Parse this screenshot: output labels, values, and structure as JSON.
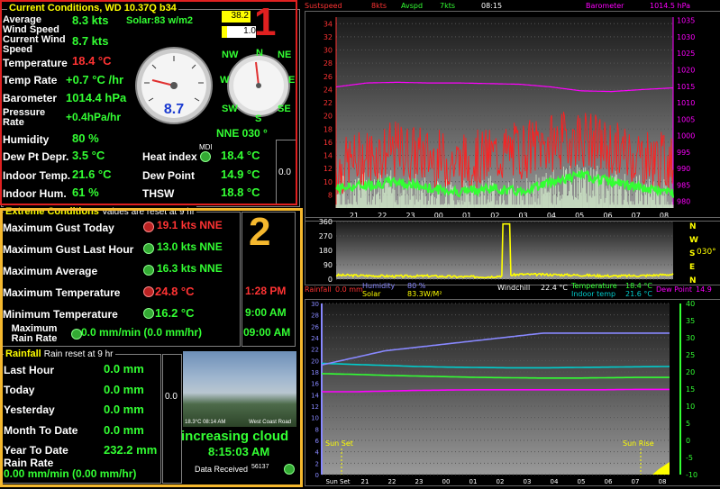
{
  "current": {
    "title": "Current Conditions, WD 10.37Q b34",
    "solar": "Solar:83 w/m2",
    "avg_speed_label": "Average Wind Speed",
    "avg_speed": "8.3 kts",
    "cur_speed_label": "Current Wind Speed",
    "cur_speed": "8.7 kts",
    "temp_label": "Temperature",
    "temp": "18.4 °C",
    "temp_rate_label": "Temp Rate",
    "temp_rate": "+0.7 °C /hr",
    "baro_label": "Barometer",
    "baro": "1014.4 hPa",
    "press_rate_label": "Pressure Rate",
    "press_rate": "+0.4hPa/hr",
    "humidity_label": "Humidity",
    "humidity": "80 %",
    "dewdep_label": "Dew Pt Depr.",
    "dewdep": "3.5 °C",
    "indoor_temp_label": "Indoor Temp.",
    "indoor_temp": "21.6 °C",
    "indoor_hum_label": "Indoor Hum.",
    "indoor_hum": "61 %",
    "heat_label": "Heat index",
    "heat": "18.4 °C",
    "mdi": "MDI",
    "dew_label": "Dew Point",
    "dew": "14.9 °C",
    "thsw_label": "THSW",
    "thsw": "18.8 °C",
    "gauge_value": "8.7",
    "small_box_top": "38.2",
    "small_box_mid": "1.0",
    "rain_bar_value": "0.0",
    "direction": "NNE  030 °",
    "compass": {
      "n": "N",
      "s": "S",
      "e": "E",
      "w": "W",
      "nw": "NW",
      "ne": "NE",
      "sw": "SW",
      "se": "SE"
    }
  },
  "extreme": {
    "title": "Extreme Conditions",
    "subtitle": "Values are reset at 9 hr",
    "gust_today_label": "Maximum Gust Today",
    "gust_today": "19.1 kts NNE",
    "gust_hour_label": "Maximum Gust Last Hour",
    "gust_hour": "13.0 kts NNE",
    "avg_label": "Maximum Average",
    "avg": "16.3 kts NNE",
    "tmax_label": "Maximum Temperature",
    "tmax": "24.8 °C",
    "tmax_time": "1:28 PM",
    "tmin_label": "Minimum Temperature",
    "tmin": "16.2 °C",
    "tmin_time": "9:00 AM",
    "rain_rate_label": "Maximum Rain Rate",
    "rain_rate": "0.0 mm/min (0.0 mm/hr)",
    "rain_rate_time": "09:00 AM"
  },
  "rainfall": {
    "title": "Rainfall",
    "subtitle": "Rain reset at 9 hr",
    "last_hour_label": "Last Hour",
    "last_hour": "0.0 mm",
    "today_label": "Today",
    "today": "0.0 mm",
    "yesterday_label": "Yesterday",
    "yesterday": "0.0 mm",
    "month_label": "Month To Date",
    "month": "0.0 mm",
    "year_label": "Year To Date",
    "year": "232.2 mm",
    "rate_label": "Rain Rate",
    "rate": "0.00 mm/min (0.00 mm/hr)",
    "bar_value": "0.0"
  },
  "camera": {
    "caption_left": "18.3°C 08:14 AM",
    "caption_right": "West Coast Road",
    "forecast": "increasing cloud",
    "time": "8:15:03 AM",
    "data_received_label": "Data Received",
    "data_received": "56137"
  },
  "annotations": {
    "box1": "1",
    "box2": "2"
  },
  "colors": {
    "good": "#33ff33",
    "alert": "#ff3333",
    "title": "#ffff00",
    "box1": "#e02020",
    "box2": "#f5b82e"
  },
  "top_chart_header": {
    "sustspeed": "Sustspeed",
    "wind_val": "8kts",
    "avspd": "Avspd",
    "avg_val": "7kts",
    "time": "08:15",
    "baro_label": "Barometer",
    "baro_val": "1014.5 hPa"
  },
  "wind_dir_chart": {
    "value_text": "030°",
    "dir_labels": [
      "N",
      "W",
      "S",
      "E",
      "N"
    ]
  },
  "bottom_chart_header": {
    "rainfall": "Rainfall",
    "rain_val": "0.0 mm",
    "humidity": "Humidity",
    "humidity_val": "80 %",
    "solar": "Solar",
    "solar_val": "83.3W/M²",
    "windchill": "Windchill",
    "windchill_val": "22.4 °C",
    "temperature": "Temperature",
    "temperature_val": "18.4 °C",
    "indoor": "Indoor temp",
    "indoor_val": "21.6 °C",
    "dewpoint": "Dew Point",
    "dewpoint_val": "14.9"
  },
  "chart_data": [
    {
      "type": "line",
      "x": [
        "21",
        "22",
        "23",
        "00",
        "01",
        "02",
        "03",
        "04",
        "05",
        "06",
        "07",
        "08"
      ],
      "y_left_ticks": [
        8,
        10,
        12,
        14,
        16,
        18,
        20,
        22,
        24,
        26,
        28,
        30,
        32,
        34
      ],
      "y_right_ticks": [
        980,
        985,
        990,
        995,
        1000,
        1005,
        1010,
        1015,
        1020,
        1025,
        1030,
        1035
      ],
      "ylim_left": [
        6,
        35
      ],
      "ylim_right": [
        978,
        1036
      ],
      "series": [
        {
          "name": "Sustspeed",
          "color": "#ff2020",
          "values": [
            10,
            12,
            13,
            12,
            11,
            12,
            13,
            14,
            15,
            13,
            12,
            11
          ]
        },
        {
          "name": "Avspd",
          "color": "#33ff33",
          "values": [
            9,
            9.5,
            10,
            9,
            8.5,
            9,
            8.5,
            10,
            11,
            10,
            9,
            8.3
          ]
        },
        {
          "name": "Barometer",
          "color": "#ff00ff",
          "values": [
            1014.8,
            1016,
            1016.2,
            1016,
            1016,
            1015.8,
            1015.6,
            1014.8,
            1013.6,
            1013.4,
            1014,
            1014.5
          ]
        }
      ]
    },
    {
      "type": "line",
      "x": [
        "21",
        "22",
        "23",
        "00",
        "01",
        "02",
        "03",
        "04",
        "05",
        "06",
        "07",
        "08"
      ],
      "y_ticks": [
        0,
        90,
        180,
        270,
        360
      ],
      "ylim": [
        0,
        360
      ],
      "series": [
        {
          "name": "Wind direction",
          "color": "#ffff00",
          "values": [
            25,
            22,
            18,
            20,
            15,
            15,
            30,
            28,
            25,
            20,
            22,
            30
          ]
        }
      ]
    },
    {
      "type": "line",
      "x": [
        "Sun Set",
        "21",
        "22",
        "23",
        "00",
        "01",
        "02",
        "03",
        "04",
        "05",
        "06",
        "07",
        "08"
      ],
      "y_left_ticks": [
        0,
        2,
        4,
        6,
        8,
        10,
        12,
        14,
        16,
        18,
        20,
        22,
        24,
        26,
        28,
        30
      ],
      "y_right_ticks": [
        -10,
        -5,
        0,
        5,
        10,
        15,
        20,
        25,
        30,
        35,
        40
      ],
      "ylim_left": [
        0,
        30
      ],
      "ylim_right": [
        -10,
        40
      ],
      "annotations": [
        "Sun Set",
        "Sun Rise"
      ],
      "series": [
        {
          "name": "Temperature",
          "color": "#33ff33",
          "values": [
            19.5,
            19.3,
            19,
            18.8,
            18.6,
            18.4,
            18.3,
            18.2,
            18.2,
            18.3,
            18.4,
            18.4
          ]
        },
        {
          "name": "Indoor temp",
          "color": "#00cccc",
          "values": [
            22.5,
            22.2,
            21.9,
            21.6,
            21.4,
            21.3,
            21.2,
            21.2,
            21.3,
            21.4,
            21.5,
            21.6
          ]
        },
        {
          "name": "Dew Point",
          "color": "#ff00ff",
          "values": [
            14.2,
            14.2,
            14.4,
            14.6,
            14.7,
            14.8,
            14.8,
            14.8,
            14.8,
            14.8,
            14.9,
            14.9
          ]
        },
        {
          "name": "Humidity",
          "color": "#8888ff",
          "values": [
            62,
            66,
            70,
            72,
            74,
            76,
            78,
            80,
            80,
            80,
            80,
            80
          ]
        }
      ]
    }
  ]
}
